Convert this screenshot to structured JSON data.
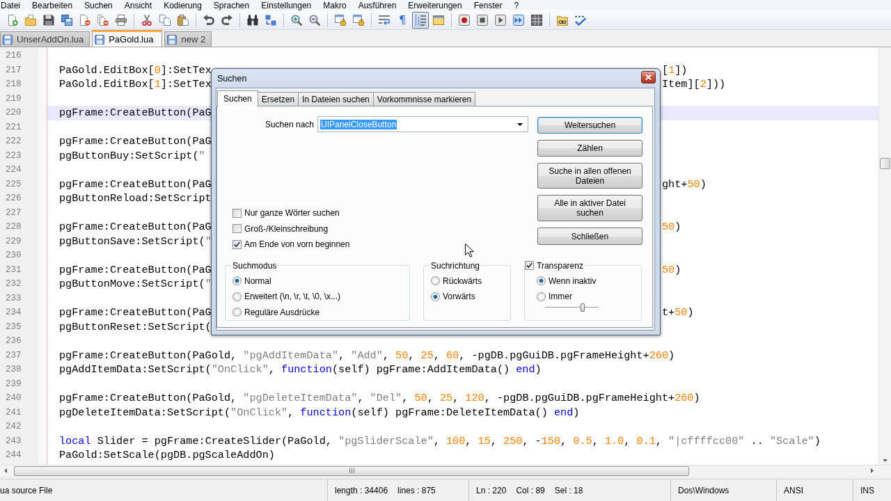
{
  "menu": [
    "Datei",
    "Bearbeiten",
    "Suchen",
    "Ansicht",
    "Kodierung",
    "Sprachen",
    "Einstellungen",
    "Makro",
    "Ausführen",
    "Erweiterungen",
    "Fenster",
    "?"
  ],
  "toolbar": [
    [
      {
        "pressed": false
      },
      {
        "pressed": false
      },
      {
        "pressed": false
      },
      {
        "pressed": false
      },
      {
        "pressed": false
      },
      {
        "pressed": false
      },
      {
        "pressed": false
      }
    ],
    [
      {
        "pressed": false
      },
      {
        "pressed": false
      },
      {
        "pressed": false
      }
    ],
    [
      {
        "pressed": false
      },
      {
        "pressed": false
      }
    ],
    [
      {
        "pressed": false
      },
      {
        "pressed": false
      }
    ],
    [
      {
        "pressed": false
      },
      {
        "pressed": false
      }
    ],
    [
      {
        "pressed": false
      },
      {
        "pressed": false
      }
    ],
    [
      {
        "pressed": false
      },
      {
        "label": "¶",
        "pressed": false
      },
      {
        "pressed": true
      },
      {
        "pressed": false
      }
    ],
    [
      {
        "pressed": false
      },
      {
        "pressed": false
      },
      {
        "pressed": false
      },
      {
        "pressed": false
      },
      {
        "pressed": false
      }
    ],
    [
      {
        "pressed": false
      },
      {
        "pressed": false
      }
    ]
  ],
  "tabs": [
    {
      "label": "UnserAddOn.lua",
      "selected": false
    },
    {
      "label": "PaGold.lua",
      "selected": true
    },
    {
      "label": "new 2",
      "selected": false
    }
  ],
  "editor": {
    "lines": [
      {
        "number": "216",
        "current": false
      },
      {
        "number": "217",
        "current": false,
        "code": [
          {
            "kind": "plain",
            "text": "PaGold.EditBox["
          },
          {
            "kind": "number",
            "text": "0"
          },
          {
            "kind": "plain",
            "text": "]:SetTex"
          }
        ],
        "tail": [
          {
            "kind": "plain",
            "text": "["
          },
          {
            "kind": "number",
            "text": "1"
          },
          {
            "kind": "plain",
            "text": "])"
          }
        ]
      },
      {
        "number": "218",
        "current": false,
        "code": [
          {
            "kind": "plain",
            "text": "PaGold.EditBox["
          },
          {
            "kind": "number",
            "text": "1"
          },
          {
            "kind": "plain",
            "text": "]:SetTex"
          }
        ],
        "tail": [
          {
            "kind": "plain",
            "text": "Item]["
          },
          {
            "kind": "number",
            "text": "2"
          },
          {
            "kind": "plain",
            "text": "]))"
          }
        ]
      },
      {
        "number": "219",
        "current": false
      },
      {
        "number": "220",
        "current": true,
        "code": [
          {
            "kind": "plain",
            "text": "pgFrame:CreateButton(PaG"
          }
        ]
      },
      {
        "number": "221",
        "current": false
      },
      {
        "number": "222",
        "current": false,
        "code": [
          {
            "kind": "plain",
            "text": "pgFrame:CreateButton(PaG"
          }
        ]
      },
      {
        "number": "223",
        "current": false,
        "code": [
          {
            "kind": "plain",
            "text": "pgButtonBuy:SetScript("
          },
          {
            "kind": "string",
            "text": "\""
          }
        ]
      },
      {
        "number": "224",
        "current": false
      },
      {
        "number": "225",
        "current": false,
        "code": [
          {
            "kind": "plain",
            "text": "pgFrame:CreateButton(PaG"
          }
        ],
        "tail": [
          {
            "kind": "plain",
            "text": "ght+"
          },
          {
            "kind": "number",
            "text": "50"
          },
          {
            "kind": "plain",
            "text": ")"
          }
        ]
      },
      {
        "number": "226",
        "current": false,
        "code": [
          {
            "kind": "plain",
            "text": "pgButtonReload:SetScript"
          }
        ]
      },
      {
        "number": "227",
        "current": false
      },
      {
        "number": "228",
        "current": false,
        "code": [
          {
            "kind": "plain",
            "text": "pgFrame:CreateButton(PaG"
          }
        ],
        "tail": [
          {
            "kind": "number",
            "text": "50"
          },
          {
            "kind": "plain",
            "text": ")"
          }
        ]
      },
      {
        "number": "229",
        "current": false,
        "code": [
          {
            "kind": "plain",
            "text": "pgButtonSave:SetScript("
          },
          {
            "kind": "string",
            "text": "\""
          }
        ]
      },
      {
        "number": "230",
        "current": false
      },
      {
        "number": "231",
        "current": false,
        "code": [
          {
            "kind": "plain",
            "text": "pgFrame:CreateButton(PaG"
          }
        ],
        "tail": [
          {
            "kind": "number",
            "text": "50"
          },
          {
            "kind": "plain",
            "text": ")"
          }
        ]
      },
      {
        "number": "232",
        "current": false,
        "code": [
          {
            "kind": "plain",
            "text": "pgButtonMove:SetScript("
          },
          {
            "kind": "string",
            "text": "\""
          }
        ]
      },
      {
        "number": "233",
        "current": false
      },
      {
        "number": "234",
        "current": false,
        "code": [
          {
            "kind": "plain",
            "text": "pgFrame:CreateButton(PaG"
          }
        ],
        "tail": [
          {
            "kind": "plain",
            "text": "t+"
          },
          {
            "kind": "number",
            "text": "50"
          },
          {
            "kind": "plain",
            "text": ")"
          }
        ]
      },
      {
        "number": "235",
        "current": false,
        "code": [
          {
            "kind": "plain",
            "text": "pgButtonReset:SetScript("
          }
        ]
      },
      {
        "number": "236",
        "current": false
      },
      {
        "number": "237",
        "current": false,
        "code": [
          {
            "kind": "plain",
            "text": "pgFrame:CreateButton(PaGold, "
          },
          {
            "kind": "string",
            "text": "\"pgAddItemData\""
          },
          {
            "kind": "plain",
            "text": ", "
          },
          {
            "kind": "string",
            "text": "\"Add\""
          },
          {
            "kind": "plain",
            "text": ", "
          },
          {
            "kind": "number",
            "text": "50"
          },
          {
            "kind": "plain",
            "text": ", "
          },
          {
            "kind": "number",
            "text": "25"
          },
          {
            "kind": "plain",
            "text": ", "
          },
          {
            "kind": "number",
            "text": "60"
          },
          {
            "kind": "plain",
            "text": ", -pgDB.pgGuiDB.pgFrameHeight+"
          },
          {
            "kind": "number",
            "text": "260"
          },
          {
            "kind": "plain",
            "text": ")"
          }
        ]
      },
      {
        "number": "238",
        "current": false,
        "code": [
          {
            "kind": "plain",
            "text": "pgAddItemData:SetScript("
          },
          {
            "kind": "string",
            "text": "\"OnClick\""
          },
          {
            "kind": "plain",
            "text": ", "
          },
          {
            "kind": "keyword",
            "text": "function"
          },
          {
            "kind": "plain",
            "text": "(self) pgFrame:AddItemData() "
          },
          {
            "kind": "keyword",
            "text": "end"
          },
          {
            "kind": "plain",
            "text": ")"
          }
        ]
      },
      {
        "number": "239",
        "current": false
      },
      {
        "number": "240",
        "current": false,
        "code": [
          {
            "kind": "plain",
            "text": "pgFrame:CreateButton(PaGold, "
          },
          {
            "kind": "string",
            "text": "\"pgDeleteItemData\""
          },
          {
            "kind": "plain",
            "text": ", "
          },
          {
            "kind": "string",
            "text": "\"Del\""
          },
          {
            "kind": "plain",
            "text": ", "
          },
          {
            "kind": "number",
            "text": "50"
          },
          {
            "kind": "plain",
            "text": ", "
          },
          {
            "kind": "number",
            "text": "25"
          },
          {
            "kind": "plain",
            "text": ", "
          },
          {
            "kind": "number",
            "text": "120"
          },
          {
            "kind": "plain",
            "text": ", -pgDB.pgGuiDB.pgFrameHeight+"
          },
          {
            "kind": "number",
            "text": "260"
          },
          {
            "kind": "plain",
            "text": ")"
          }
        ]
      },
      {
        "number": "241",
        "current": false,
        "code": [
          {
            "kind": "plain",
            "text": "pgDeleteItemData:SetScript("
          },
          {
            "kind": "string",
            "text": "\"OnClick\""
          },
          {
            "kind": "plain",
            "text": ", "
          },
          {
            "kind": "keyword",
            "text": "function"
          },
          {
            "kind": "plain",
            "text": "(self) pgFrame:DeleteItemData() "
          },
          {
            "kind": "keyword",
            "text": "end"
          },
          {
            "kind": "plain",
            "text": ")"
          }
        ]
      },
      {
        "number": "242",
        "current": false
      },
      {
        "number": "243",
        "current": false,
        "code": [
          {
            "kind": "keyword",
            "text": "local"
          },
          {
            "kind": "plain",
            "text": " Slider = pgFrame:CreateSlider(PaGold, "
          },
          {
            "kind": "string",
            "text": "\"pgSliderScale\""
          },
          {
            "kind": "plain",
            "text": ", "
          },
          {
            "kind": "number",
            "text": "100"
          },
          {
            "kind": "plain",
            "text": ", "
          },
          {
            "kind": "number",
            "text": "15"
          },
          {
            "kind": "plain",
            "text": ", "
          },
          {
            "kind": "number",
            "text": "250"
          },
          {
            "kind": "plain",
            "text": ", -"
          },
          {
            "kind": "number",
            "text": "150"
          },
          {
            "kind": "plain",
            "text": ", "
          },
          {
            "kind": "number",
            "text": "0.5"
          },
          {
            "kind": "plain",
            "text": ", "
          },
          {
            "kind": "number",
            "text": "1.0"
          },
          {
            "kind": "plain",
            "text": ", "
          },
          {
            "kind": "number",
            "text": "0.1"
          },
          {
            "kind": "plain",
            "text": ", "
          },
          {
            "kind": "string",
            "text": "\"|cffffcc00\""
          },
          {
            "kind": "plain",
            "text": " .. "
          },
          {
            "kind": "string",
            "text": "\"Scale\""
          },
          {
            "kind": "plain",
            "text": ")"
          }
        ]
      },
      {
        "number": "244",
        "current": false,
        "code": [
          {
            "kind": "plain",
            "text": "PaGold:SetScale(pgDB.pgScaleAddOn)"
          }
        ]
      }
    ]
  },
  "dialog": {
    "title": "Suchen",
    "tabs": [
      {
        "label": "Suchen",
        "selected": true
      },
      {
        "label": "Ersetzen",
        "selected": false
      },
      {
        "label": "In Dateien suchen",
        "selected": false
      },
      {
        "label": "Vorkommnisse markieren",
        "selected": false
      }
    ],
    "search_for": {
      "label": "Suchen nach",
      "value": "UIPanelCloseButton",
      "value_selected": true
    },
    "buttons": [
      {
        "label": "Weitersuchen",
        "default": true
      },
      {
        "label": "Zählen",
        "default": false
      },
      {
        "label": "Suche in allen offenen Dateien",
        "default": false
      },
      {
        "label": "Alle in aktiver Datei suchen",
        "default": false
      },
      {
        "label": "Schließen",
        "default": false
      }
    ],
    "options": [
      {
        "label": "Nur ganze Wörter suchen",
        "checked": false
      },
      {
        "label": "Groß-/Kleinschreibung",
        "checked": false
      },
      {
        "label": "Am Ende von vorn beginnen",
        "checked": true
      }
    ],
    "search_mode": {
      "title": "Suchmodus",
      "options": [
        {
          "label": "Normal",
          "selected": true
        },
        {
          "label": "Erweitert (\\n, \\r, \\t, \\0, \\x...)",
          "selected": false
        },
        {
          "label": "Reguläre Ausdrücke",
          "selected": false
        }
      ]
    },
    "direction": {
      "title": "Suchrichtung",
      "options": [
        {
          "label": "Rückwärts",
          "selected": false
        },
        {
          "label": "Vorwärts",
          "selected": true
        }
      ]
    },
    "transparency": {
      "label": "Transparenz",
      "checked": true,
      "options": [
        {
          "label": "Wenn inaktiv",
          "selected": true
        },
        {
          "label": "Immer",
          "selected": false
        }
      ],
      "level": 0.7
    }
  },
  "status_bar": {
    "panels": [
      [
        "ua source File"
      ],
      [
        "length : 34406",
        "lines : 875"
      ],
      [
        "Ln : 220",
        "Col : 89",
        "Sel : 18"
      ],
      [
        "Dos\\Windows"
      ],
      [
        "ANSI"
      ],
      [
        "INS"
      ]
    ]
  }
}
